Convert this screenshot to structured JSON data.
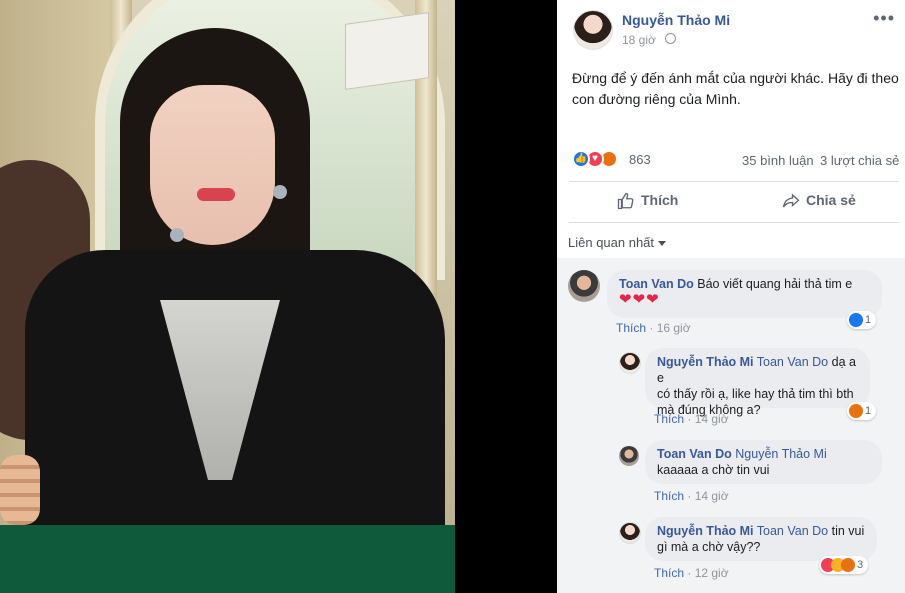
{
  "post": {
    "author": "Nguyễn Thảo Mi",
    "time": "18 giờ",
    "more_label": "•••",
    "text": "Đừng để ý đến ánh mắt của người khác. Hãy đi theo con đường riêng của Mình.",
    "reaction_count": "863",
    "comments_count": "35 bình luận",
    "shares_count": "3 lượt chia sẻ",
    "like_label": "Thích",
    "share_label": "Chia sẻ"
  },
  "sort_label": "Liên quan nhất",
  "comments": [
    {
      "author": "Toan Van Do",
      "text": "Báo viết quang hải thả tim e",
      "hearts": "❤❤❤",
      "like_label": "Thích",
      "time": "16 giờ",
      "reaction_count": "1"
    },
    {
      "author": "Nguyễn Thảo Mi",
      "mention": "Toan Van Do",
      "text_line1": "dạ a e",
      "text_line2": "có thấy rồi ạ, like hay thả tim thì bth",
      "text_line3": "mà đúng không a?",
      "like_label": "Thích",
      "time": "14 giờ",
      "reaction_count": "1"
    },
    {
      "author": "Toan Van Do",
      "mention": "Nguyễn Thảo Mi",
      "text": "kaaaaa a chờ tin vui",
      "like_label": "Thích",
      "time": "14 giờ"
    },
    {
      "author": "Nguyễn Thảo Mi",
      "mention": "Toan Van Do",
      "text_line1": "tin vui",
      "text_line2": "gì mà a chờ vậy??",
      "like_label": "Thích",
      "time": "12 giờ",
      "reaction_count": "3"
    }
  ],
  "colors": {
    "name_link": "#385898",
    "like_blue": "#1877f2",
    "love_red": "#f33e58",
    "angry_orange": "#e9710f",
    "muted": "#90949c"
  },
  "icons": {
    "thumbs_up": "thumbs-up-icon",
    "share": "share-arrow-icon",
    "globe": "globe-icon"
  }
}
